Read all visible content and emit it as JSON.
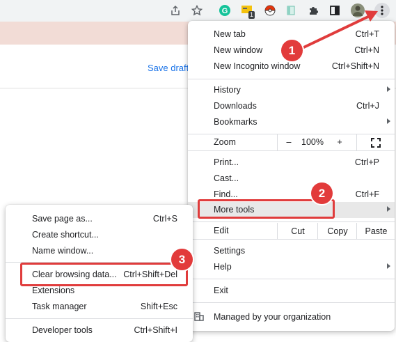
{
  "colors": {
    "accent": "#1a73e8",
    "annotation": "#e03c3c",
    "infobar": "#f2dcd6"
  },
  "toolbar": {
    "icons": [
      "share-icon",
      "bookmark-star-icon",
      "grammarly-extension-icon",
      "extension-badge-icon",
      "pokeball-extension-icon",
      "reader-extension-icon",
      "extensions-puzzle-icon",
      "side-panel-icon",
      "profile-avatar",
      "kebab-menu-icon"
    ],
    "badge_count": "1"
  },
  "page": {
    "save_draft": "Save draft"
  },
  "main_menu": {
    "new_tab": {
      "label": "New tab",
      "shortcut": "Ctrl+T"
    },
    "new_window": {
      "label": "New window",
      "shortcut": "Ctrl+N"
    },
    "new_incognito": {
      "label": "New Incognito window",
      "shortcut": "Ctrl+Shift+N"
    },
    "history": {
      "label": "History"
    },
    "downloads": {
      "label": "Downloads",
      "shortcut": "Ctrl+J"
    },
    "bookmarks": {
      "label": "Bookmarks"
    },
    "zoom": {
      "label": "Zoom",
      "minus": "–",
      "value": "100%",
      "plus": "+"
    },
    "print": {
      "label": "Print...",
      "shortcut": "Ctrl+P"
    },
    "cast": {
      "label": "Cast..."
    },
    "find": {
      "label": "Find...",
      "shortcut": "Ctrl+F"
    },
    "more_tools": {
      "label": "More tools"
    },
    "edit": {
      "label": "Edit",
      "cut": "Cut",
      "copy": "Copy",
      "paste": "Paste"
    },
    "settings": {
      "label": "Settings"
    },
    "help": {
      "label": "Help"
    },
    "exit": {
      "label": "Exit"
    },
    "managed": {
      "label": "Managed by your organization"
    }
  },
  "sub_menu": {
    "save_page": {
      "label": "Save page as...",
      "shortcut": "Ctrl+S"
    },
    "create_shortcut": {
      "label": "Create shortcut..."
    },
    "name_window": {
      "label": "Name window..."
    },
    "clear_browsing": {
      "label": "Clear browsing data...",
      "shortcut": "Ctrl+Shift+Del"
    },
    "extensions": {
      "label": "Extensions"
    },
    "task_manager": {
      "label": "Task manager",
      "shortcut": "Shift+Esc"
    },
    "developer_tools": {
      "label": "Developer tools",
      "shortcut": "Ctrl+Shift+I"
    }
  },
  "annotations": {
    "step1": "1",
    "step2": "2",
    "step3": "3"
  }
}
